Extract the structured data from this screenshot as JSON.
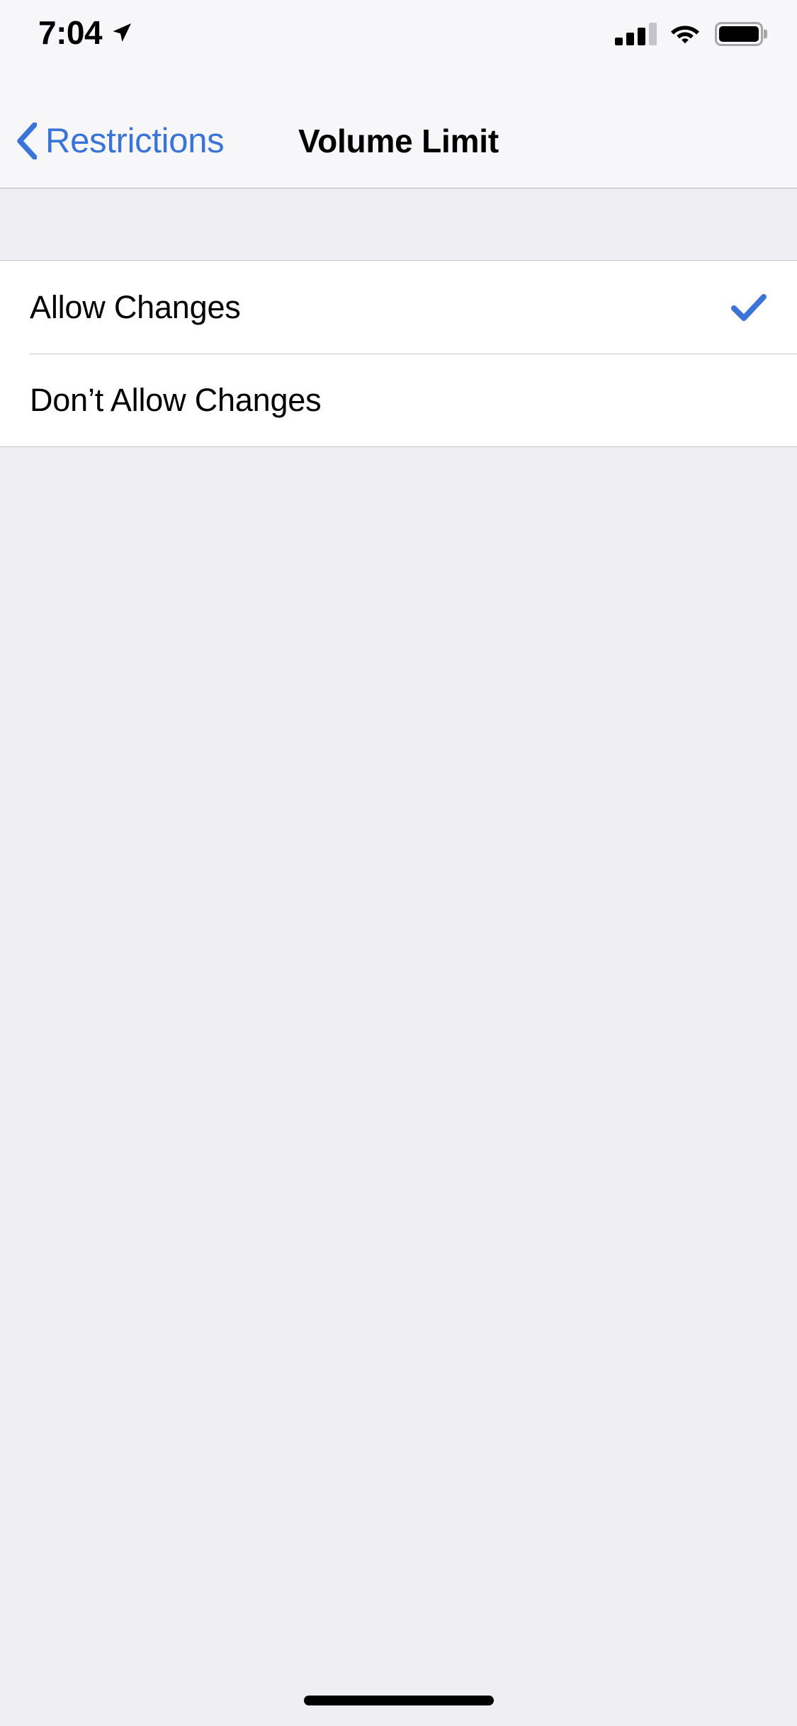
{
  "status_bar": {
    "time": "7:04",
    "location_arrow_icon": "location-arrow-icon",
    "signal_icon": "cellular-signal-icon",
    "signal_bars_filled": 3,
    "signal_bars_total": 4,
    "wifi_icon": "wifi-icon",
    "battery_icon": "battery-icon",
    "battery_level_percent": 100
  },
  "nav_bar": {
    "back_label": "Restrictions",
    "back_chevron_icon": "chevron-left-icon",
    "title": "Volume Limit"
  },
  "settings_list": {
    "rows": [
      {
        "label": "Allow Changes",
        "selected": true,
        "checkmark_icon": "checkmark-icon"
      },
      {
        "label": "Don’t Allow Changes",
        "selected": false,
        "checkmark_icon": "checkmark-icon"
      }
    ]
  },
  "home_indicator": {
    "name": "home-indicator"
  },
  "colors": {
    "accent_blue": "#3B74D7",
    "page_background": "#EFEEF3",
    "bar_background": "#F7F7F9",
    "row_background": "#FFFFFF",
    "separator": "#C8C7CC",
    "text_primary": "#000000"
  }
}
